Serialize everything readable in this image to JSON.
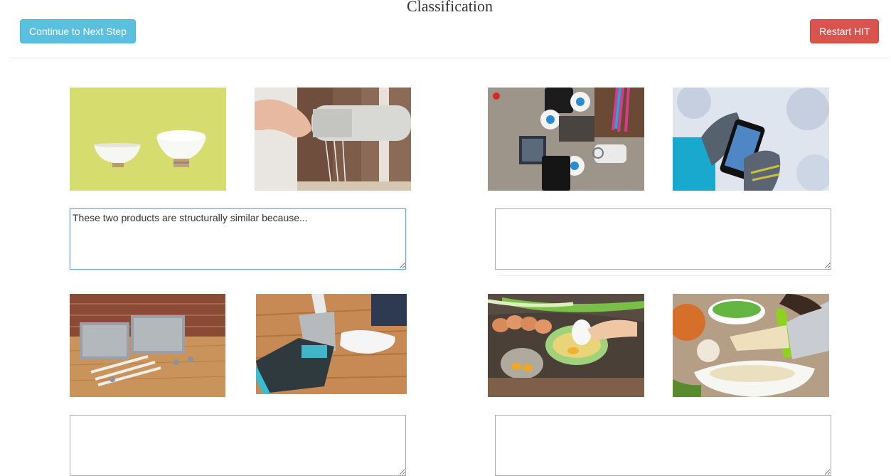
{
  "page": {
    "title": "Classification"
  },
  "toolbar": {
    "continue_label": "Continue to Next Step",
    "restart_label": "Restart HIT"
  },
  "pairs": [
    {
      "images": [
        "bowl-product-image",
        "grater-product-image"
      ],
      "answer": "These two products are structurally similar because...",
      "focused": true
    },
    {
      "images": [
        "power-strip-product-image",
        "phone-gloves-product-image"
      ],
      "answer": ""
    },
    {
      "images": [
        "folding-shelf-product-image",
        "dustpan-product-image"
      ],
      "answer": ""
    },
    {
      "images": [
        "egg-separator-product-image",
        "herb-chopper-product-image"
      ],
      "answer": ""
    }
  ],
  "colors": {
    "continue_button": "#5bc0de",
    "restart_button": "#d9534f",
    "focus_border": "#6fa1e6"
  }
}
